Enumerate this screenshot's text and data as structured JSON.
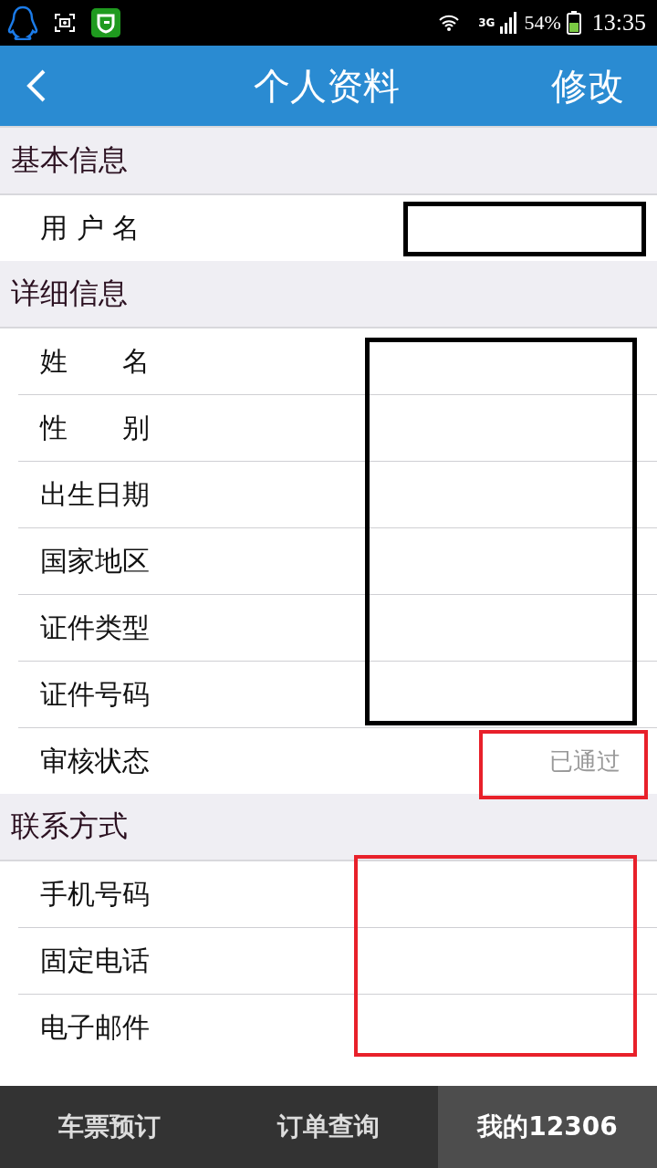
{
  "status_bar": {
    "network": "3G",
    "battery": "54%",
    "time": "13:35"
  },
  "header": {
    "title": "个人资料",
    "action": "修改"
  },
  "sections": [
    {
      "title": "基本信息",
      "rows": [
        {
          "label": "用 户 名"
        }
      ]
    },
    {
      "title": "详细信息",
      "rows": [
        {
          "label": "姓　　名"
        },
        {
          "label": "性　　别"
        },
        {
          "label": "出生日期"
        },
        {
          "label": "国家地区"
        },
        {
          "label": "证件类型"
        },
        {
          "label": "证件号码"
        },
        {
          "label": "审核状态",
          "value": "已通过"
        }
      ]
    },
    {
      "title": "联系方式",
      "rows": [
        {
          "label": "手机号码"
        },
        {
          "label": "固定电话"
        },
        {
          "label": "电子邮件"
        }
      ]
    }
  ],
  "tabs": [
    {
      "label": "车票预订",
      "selected": false
    },
    {
      "label": "订单查询",
      "selected": false
    },
    {
      "label": "我的12306",
      "selected": true
    }
  ]
}
